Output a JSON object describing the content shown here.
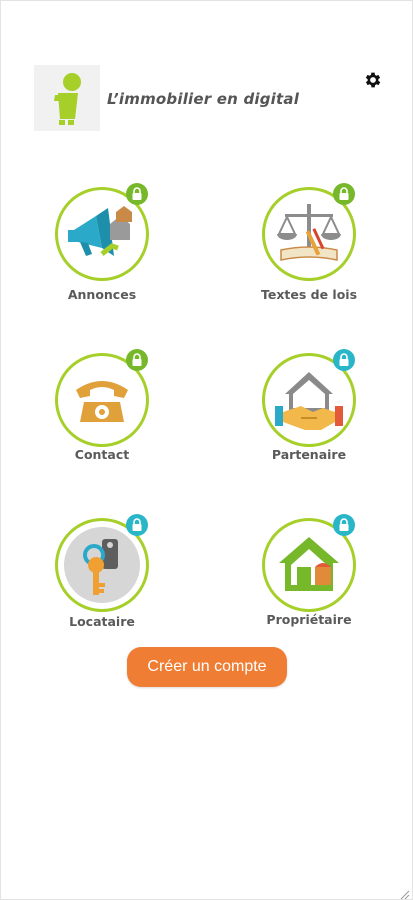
{
  "header": {
    "title": "L’immobilier en digital",
    "logo_icon": "info-person-logo",
    "settings_icon": "gear-icon"
  },
  "tiles": [
    {
      "label": "Annonces",
      "icon": "megaphone-houses-icon",
      "lock_color": "#76b82a"
    },
    {
      "label": "Textes de lois",
      "icon": "scales-of-justice-icon",
      "lock_color": "#76b82a"
    },
    {
      "label": "Contact",
      "icon": "telephone-icon",
      "lock_color": "#76b82a"
    },
    {
      "label": "Partenaire",
      "icon": "handshake-house-icon",
      "lock_color": "#29b6c8"
    },
    {
      "label": "Locataire",
      "icon": "keys-icon",
      "lock_color": "#29b6c8"
    },
    {
      "label": "Propriétaire",
      "icon": "green-house-icon",
      "lock_color": "#29b6c8"
    }
  ],
  "cta": {
    "label": "Créer un compte"
  },
  "colors": {
    "ring": "#a6cf2a",
    "lock_green": "#76b82a",
    "lock_teal": "#29b6c8",
    "cta": "#ef7d34"
  }
}
